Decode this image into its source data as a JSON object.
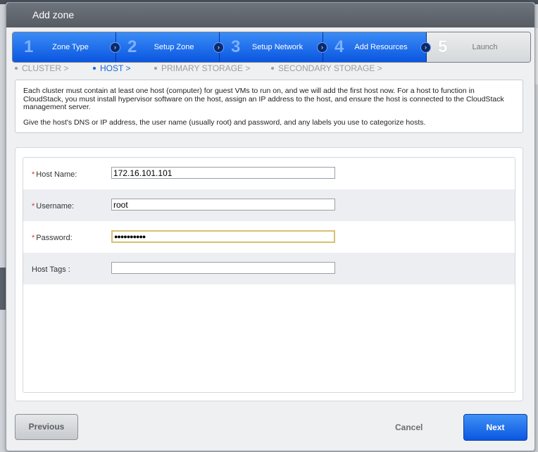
{
  "dialog": {
    "title": "Add zone"
  },
  "steps": [
    {
      "num": "1",
      "label": "Zone Type"
    },
    {
      "num": "2",
      "label": "Setup Zone"
    },
    {
      "num": "3",
      "label": "Setup Network"
    },
    {
      "num": "4",
      "label": "Add Resources"
    },
    {
      "num": "5",
      "label": "Launch"
    }
  ],
  "substeps": [
    {
      "label": "CLUSTER >"
    },
    {
      "label": "HOST >"
    },
    {
      "label": "PRIMARY STORAGE >"
    },
    {
      "label": "SECONDARY STORAGE >"
    }
  ],
  "description": {
    "para1": "Each cluster must contain at least one host (computer) for guest VMs to run on, and we will add the first host now. For a host to function in CloudStack, you must install hypervisor software on the host, assign an IP address to the host, and ensure the host is connected to the CloudStack management server.",
    "para2": "Give the host's DNS or IP address, the user name (usually root) and password, and any labels you use to categorize hosts."
  },
  "form": {
    "host_name": {
      "label": "Host Name:",
      "value": "172.16.101.101"
    },
    "username": {
      "label": "Username:",
      "value": "root"
    },
    "password": {
      "label": "Password:",
      "value": "●●●●●●●●●●"
    },
    "host_tags": {
      "label": "Host Tags :",
      "value": ""
    },
    "required_mark": "*"
  },
  "buttons": {
    "previous": "Previous",
    "cancel": "Cancel",
    "next": "Next"
  },
  "colors": {
    "active_step": "#0a56e0",
    "active_substep": "#1565d8",
    "required": "#dd3333"
  }
}
